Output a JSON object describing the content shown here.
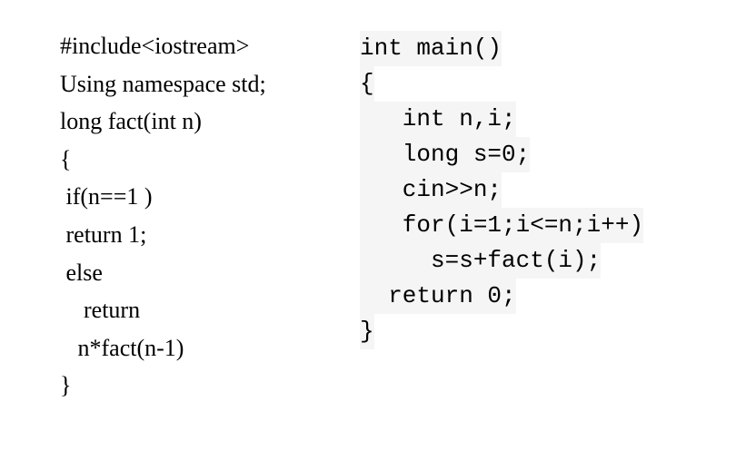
{
  "left": {
    "l1": "#include<iostream>",
    "l2": "Using namespace std;",
    "l3": "long fact(int n)",
    "l4": "{",
    "l5": " if(n==1 )",
    "l6": " return 1;",
    "l7": " else",
    "l8": "    return",
    "l9": "   n*fact(n-1)",
    "l10": "}"
  },
  "right": {
    "r1": "int main()",
    "r2": "{",
    "r3": "   int n,i;",
    "r4": "   long s=0;",
    "r5": "   cin>>n;",
    "r6": "   for(i=1;i<=n;i++)",
    "r7": "     s=s+fact(i);",
    "r8": "  return 0;",
    "r9": "}"
  }
}
